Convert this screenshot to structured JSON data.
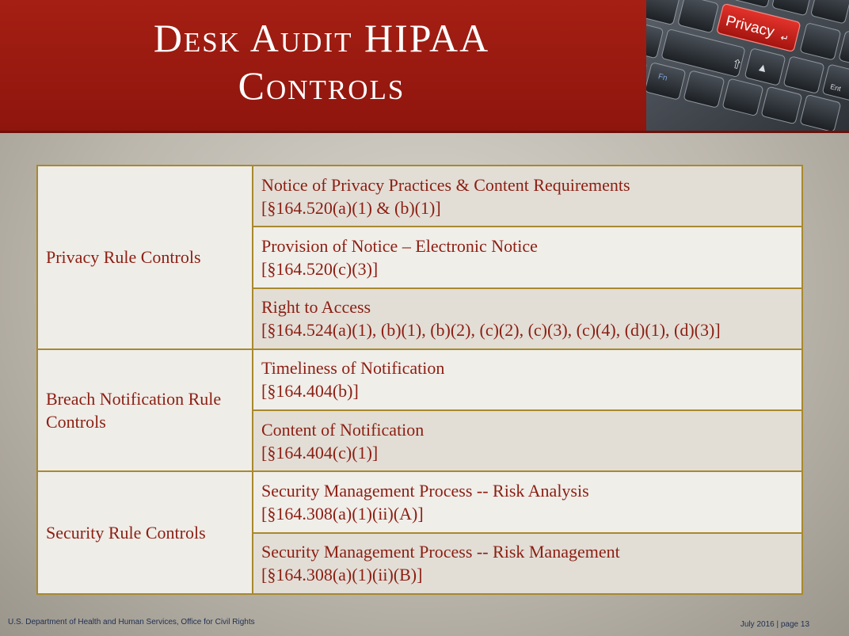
{
  "slide": {
    "title_line1": "Desk Audit HIPAA",
    "title_line2": "Controls",
    "image_key_label": "Privacy",
    "image_key_glyph": "↵",
    "image_fn_label": "Fn",
    "image_enter_label": "Ent"
  },
  "table": {
    "groups": [
      {
        "category": "Privacy Rule Controls",
        "items": [
          {
            "name": "Notice of Privacy Practices & Content Requirements",
            "cite": "[§164.520(a)(1) & (b)(1)]"
          },
          {
            "name": "Provision of Notice – Electronic Notice",
            "cite": "[§164.520(c)(3)]"
          },
          {
            "name": "Right to Access",
            "cite": "[§164.524(a)(1), (b)(1), (b)(2), (c)(2), (c)(3),  (c)(4), (d)(1), (d)(3)]"
          }
        ]
      },
      {
        "category": "Breach Notification Rule Controls",
        "items": [
          {
            "name": "Timeliness of Notification",
            "cite": "[§164.404(b)]"
          },
          {
            "name": "Content of Notification",
            "cite": "[§164.404(c)(1)]"
          }
        ]
      },
      {
        "category": "Security Rule Controls",
        "items": [
          {
            "name": "Security Management Process --  Risk Analysis",
            "cite": "[§164.308(a)(1)(ii)(A)]"
          },
          {
            "name": "Security Management Process -- Risk Management",
            "cite": "[§164.308(a)(1)(ii)(B)]"
          }
        ]
      }
    ]
  },
  "footer": {
    "left": "U.S. Department of Health and Human Services, Office for Civil Rights",
    "right": "July 2016 | page 13"
  },
  "colors": {
    "header_red": "#9b1a10",
    "text_red": "#8c1e12",
    "border_gold": "#a8892d",
    "footer_navy": "#1f2f52"
  }
}
